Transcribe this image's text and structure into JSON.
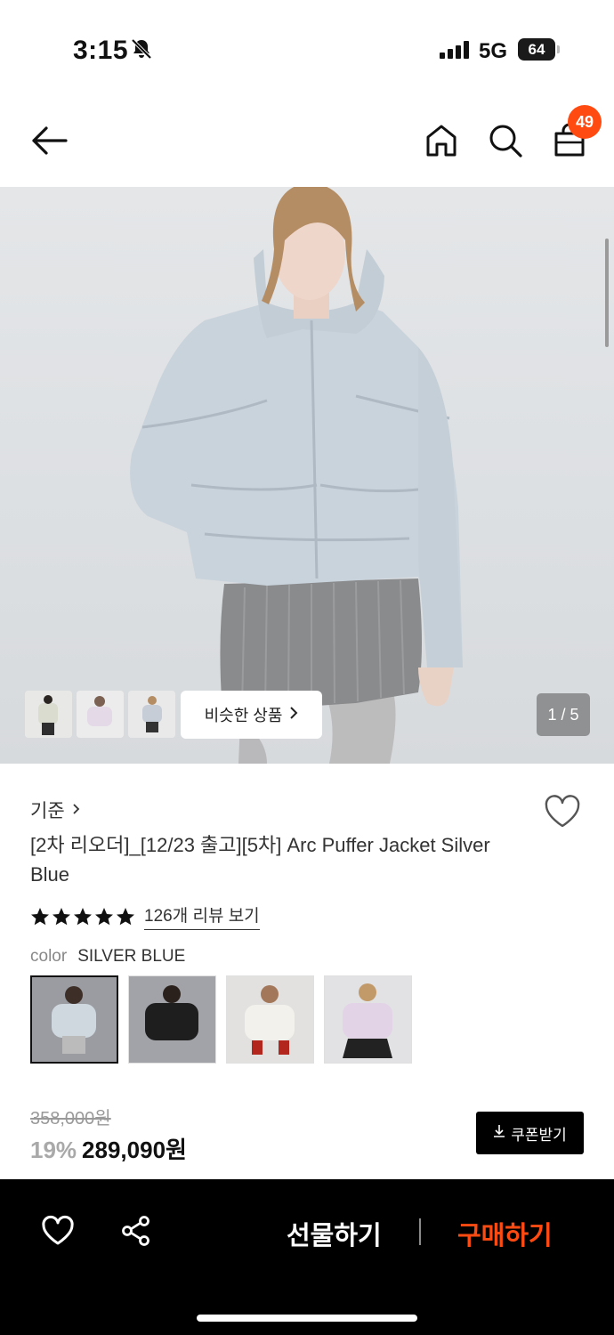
{
  "status": {
    "time": "3:15",
    "network": "5G",
    "battery": "64"
  },
  "nav": {
    "cart_count": "49"
  },
  "hero": {
    "similar_label": "비슷한 상품",
    "pager": "1 / 5"
  },
  "product": {
    "brand": "기준",
    "title": "[2차 리오더]_[12/23 출고][5차] Arc Puffer Jacket Silver Blue",
    "rating_stars": 5,
    "review_link": "126개 리뷰 보기",
    "color_label": "color",
    "color_value": "SILVER BLUE",
    "original_price": "358,000원",
    "discount": "19%",
    "price": "289,090원",
    "coupon_label": "쿠폰받기"
  },
  "bottom": {
    "gift_label": "선물하기",
    "buy_label": "구매하기"
  },
  "colors": {
    "accent": "#FF4B12",
    "jacket": "#C9D3DC"
  }
}
